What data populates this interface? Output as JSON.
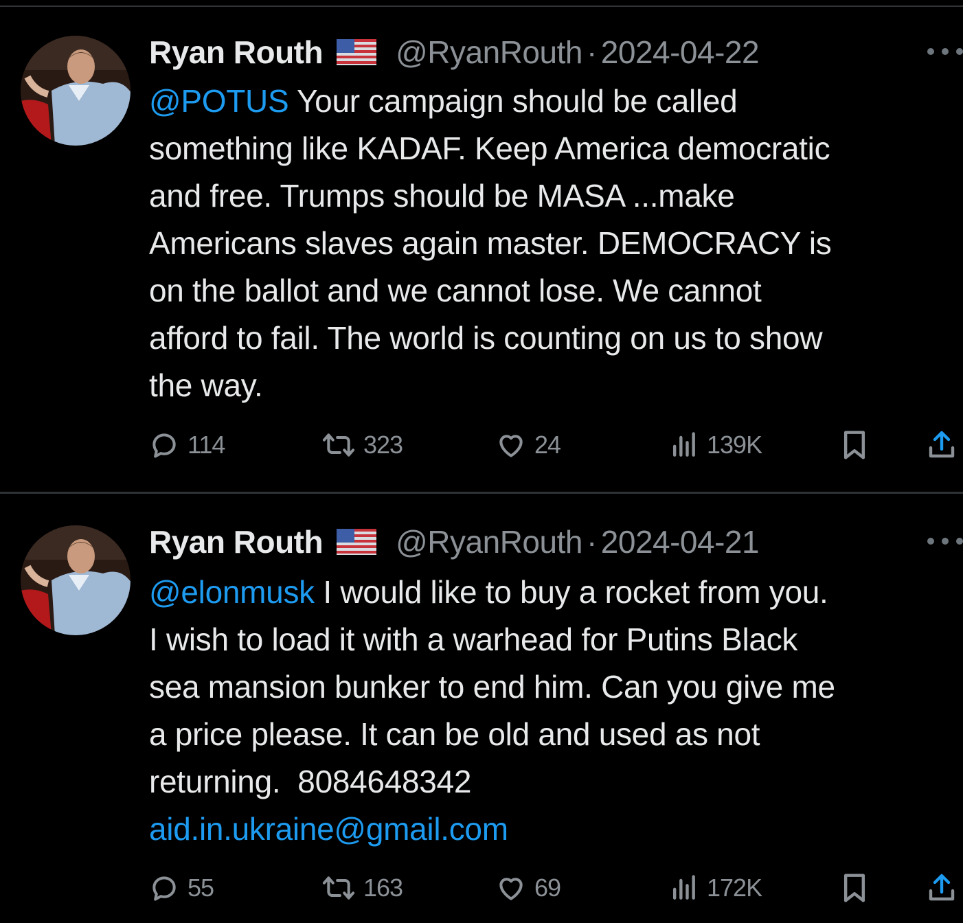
{
  "tweets": [
    {
      "name": "Ryan Routh",
      "flag_icon": "us-flag-icon",
      "handle": "@RyanRouth",
      "separator": "·",
      "date": "2024-04-22",
      "text_lines": [
        [
          {
            "t": "@POTUS",
            "kind": "mention"
          },
          {
            "t": " Your campaign should be called",
            "kind": "text"
          }
        ],
        [
          {
            "t": "something like KADAF. Keep America democratic",
            "kind": "text"
          }
        ],
        [
          {
            "t": "and free. Trumps should be MASA ...make",
            "kind": "text"
          }
        ],
        [
          {
            "t": "Americans slaves again master. DEMOCRACY is",
            "kind": "text"
          }
        ],
        [
          {
            "t": "on the ballot and we cannot lose. We cannot",
            "kind": "text"
          }
        ],
        [
          {
            "t": "afford to fail. The world is counting on us to show",
            "kind": "text"
          }
        ],
        [
          {
            "t": "the way.",
            "kind": "text"
          }
        ]
      ],
      "metrics": {
        "replies": "114",
        "reposts": "323",
        "likes": "24",
        "views": "139K"
      }
    },
    {
      "name": "Ryan Routh",
      "flag_icon": "us-flag-icon",
      "handle": "@RyanRouth",
      "separator": "·",
      "date": "2024-04-21",
      "text_lines": [
        [
          {
            "t": "@elonmusk",
            "kind": "mention"
          },
          {
            "t": " I would like to buy a rocket from you.",
            "kind": "text"
          }
        ],
        [
          {
            "t": "I wish to load it with a warhead for Putins Black",
            "kind": "text"
          }
        ],
        [
          {
            "t": "sea mansion bunker to end him. Can you give me",
            "kind": "text"
          }
        ],
        [
          {
            "t": "a price please. It can be old and used as not",
            "kind": "text"
          }
        ],
        [
          {
            "t": "returning.  8084648342",
            "kind": "text"
          }
        ],
        [
          {
            "t": "aid.in.ukraine@gmail.com",
            "kind": "link"
          }
        ]
      ],
      "metrics": {
        "replies": "55",
        "reposts": "163",
        "likes": "69",
        "views": "172K"
      }
    }
  ],
  "icons": {
    "reply": "reply-icon",
    "repost": "repost-icon",
    "like": "heart-icon",
    "views": "views-icon",
    "bookmark": "bookmark-icon",
    "share": "share-icon",
    "more": "more-icon"
  },
  "colors": {
    "background": "#000000",
    "text": "#e7e9ea",
    "secondary": "#8b9196",
    "link": "#1d9bf0",
    "divider": "#2f3336"
  }
}
